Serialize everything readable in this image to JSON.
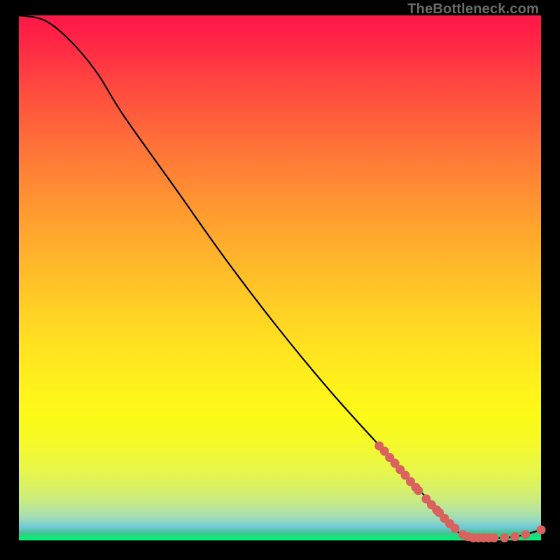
{
  "attribution": "TheBottleneck.com",
  "colors": {
    "curve_stroke": "#000000",
    "marker_fill": "#d9625f",
    "marker_stroke": "#d9625f"
  },
  "chart_data": {
    "type": "line",
    "title": "",
    "xlabel": "",
    "ylabel": "",
    "xlim": [
      0,
      100
    ],
    "ylim": [
      0,
      100
    ],
    "curve_points": [
      {
        "x": 0,
        "y": 100
      },
      {
        "x": 5,
        "y": 99
      },
      {
        "x": 10,
        "y": 95
      },
      {
        "x": 15,
        "y": 89
      },
      {
        "x": 20,
        "y": 81
      },
      {
        "x": 30,
        "y": 67
      },
      {
        "x": 40,
        "y": 53
      },
      {
        "x": 50,
        "y": 40
      },
      {
        "x": 60,
        "y": 28
      },
      {
        "x": 70,
        "y": 17
      },
      {
        "x": 80,
        "y": 6
      },
      {
        "x": 85,
        "y": 1
      },
      {
        "x": 90,
        "y": 0.5
      },
      {
        "x": 95,
        "y": 0.7
      },
      {
        "x": 100,
        "y": 2
      }
    ],
    "markers": [
      {
        "x": 69,
        "y": 18
      },
      {
        "x": 70,
        "y": 17
      },
      {
        "x": 71,
        "y": 15.8
      },
      {
        "x": 72,
        "y": 14.7
      },
      {
        "x": 73,
        "y": 13.5
      },
      {
        "x": 74,
        "y": 12.4
      },
      {
        "x": 75,
        "y": 11.2
      },
      {
        "x": 76,
        "y": 10.1
      },
      {
        "x": 76.5,
        "y": 9.5
      },
      {
        "x": 78,
        "y": 7.9
      },
      {
        "x": 79,
        "y": 6.8
      },
      {
        "x": 80,
        "y": 5.8
      },
      {
        "x": 80.5,
        "y": 5.3
      },
      {
        "x": 81.5,
        "y": 4.2
      },
      {
        "x": 82.5,
        "y": 3.2
      },
      {
        "x": 83.5,
        "y": 2.3
      },
      {
        "x": 85,
        "y": 1.1
      },
      {
        "x": 86,
        "y": 0.7
      },
      {
        "x": 87,
        "y": 0.5
      },
      {
        "x": 88,
        "y": 0.5
      },
      {
        "x": 89,
        "y": 0.5
      },
      {
        "x": 90,
        "y": 0.5
      },
      {
        "x": 91,
        "y": 0.5
      },
      {
        "x": 93,
        "y": 0.5
      },
      {
        "x": 95,
        "y": 0.7
      },
      {
        "x": 97,
        "y": 1.1
      },
      {
        "x": 100,
        "y": 2.0
      }
    ]
  }
}
